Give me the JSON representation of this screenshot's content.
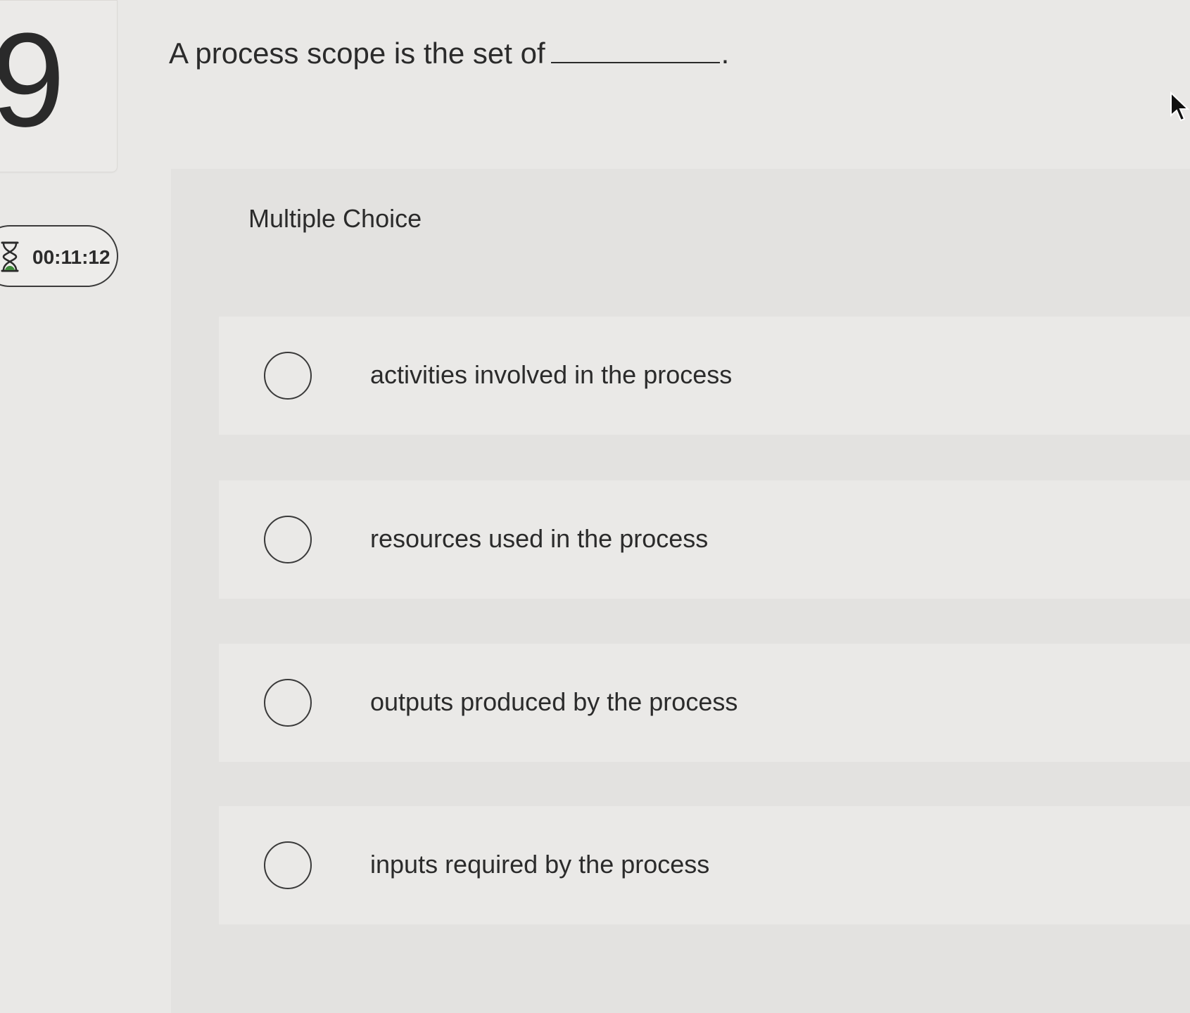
{
  "question": {
    "number": "9",
    "stem_prefix": "A process scope is the set of",
    "stem_suffix": "."
  },
  "timer": {
    "value": "00:11:12",
    "icon": "hourglass-icon"
  },
  "answer_panel": {
    "type_label": "Multiple Choice",
    "choices": [
      {
        "label": "activities involved in the process",
        "selected": false
      },
      {
        "label": "resources used in the process",
        "selected": false
      },
      {
        "label": "outputs produced by the process",
        "selected": false
      },
      {
        "label": "inputs required by the process",
        "selected": false
      }
    ]
  },
  "cursor": {
    "icon": "mouse-pointer-icon"
  },
  "colors": {
    "background": "#e9e8e6",
    "panel": "#e3e2e0",
    "choice_row": "#eae9e7",
    "text": "#2b2b2b"
  }
}
